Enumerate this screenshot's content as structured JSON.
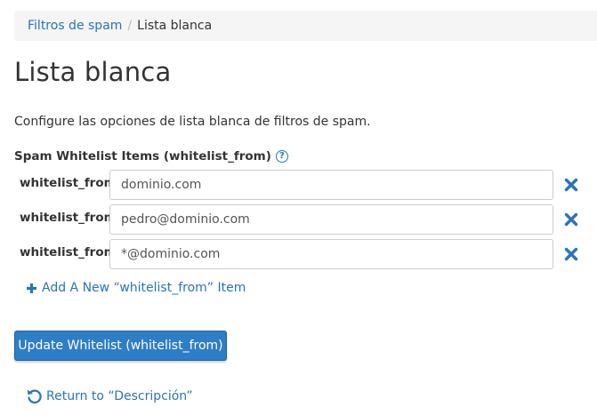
{
  "breadcrumb": {
    "parent_label": "Filtros de spam",
    "separator": "/",
    "current_label": "Lista blanca"
  },
  "page": {
    "title": "Lista blanca",
    "description": "Configure las opciones de lista blanca de filtros de spam."
  },
  "whitelist": {
    "section_label": "Spam Whitelist Items (whitelist_from)",
    "help_icon": "question-circle-icon",
    "items": [
      {
        "label": "whitelist_from",
        "value": "dominio.com",
        "remove_icon": "close-icon"
      },
      {
        "label": "whitelist_from",
        "value": "pedro@dominio.com",
        "remove_icon": "close-icon"
      },
      {
        "label": "whitelist_from",
        "value": "*@dominio.com",
        "remove_icon": "close-icon"
      }
    ],
    "add_label": "Add A New “whitelist_from” Item",
    "add_icon": "plus-icon"
  },
  "actions": {
    "update_label": "Update Whitelist (whitelist_from)",
    "return_label": "Return to “Descripción”",
    "return_icon": "undo-icon"
  },
  "colors": {
    "link": "#2b74b8",
    "primary_button": "#2e7dc7",
    "breadcrumb_bg": "#f5f5f5"
  }
}
